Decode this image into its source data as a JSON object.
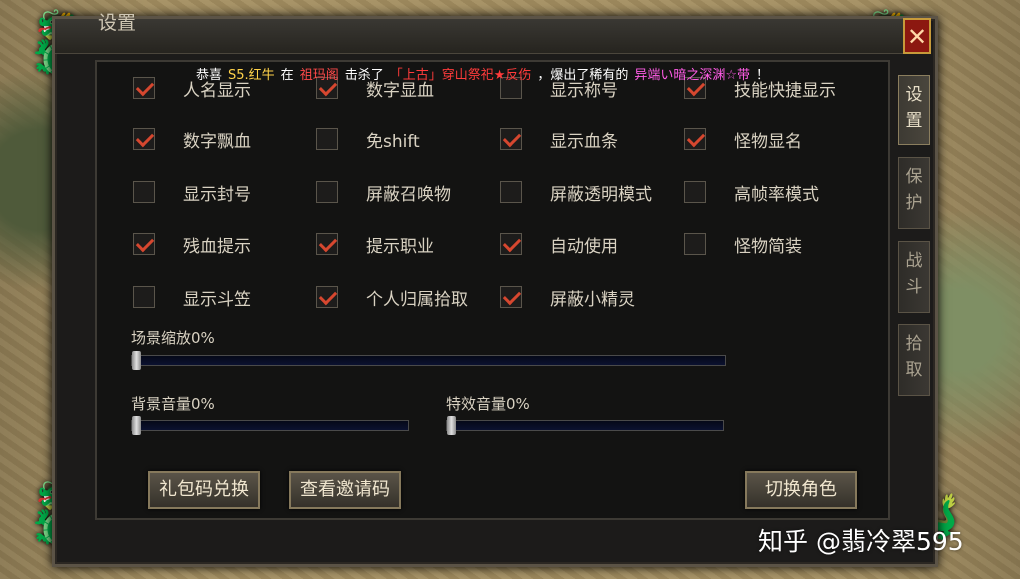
{
  "window": {
    "title": "设置",
    "close_glyph": "✕"
  },
  "broadcast": [
    {
      "text": "恭喜",
      "color": "#ffffff"
    },
    {
      "text": "S5.红牛",
      "color": "#ffd24a"
    },
    {
      "text": "在",
      "color": "#ffffff"
    },
    {
      "text": "祖玛阁",
      "color": "#ff4a4a"
    },
    {
      "text": "击杀了",
      "color": "#ffffff"
    },
    {
      "text": "「上古」穿山祭祀★反伤",
      "color": "#ff3b3b"
    },
    {
      "text": "，爆出了稀有的",
      "color": "#ffffff"
    },
    {
      "text": "异端い暗之深渊☆带",
      "color": "#ff5ce6"
    },
    {
      "text": "！",
      "color": "#ffffff"
    }
  ],
  "options": [
    {
      "label": "人名显示",
      "checked": true
    },
    {
      "label": "数字显血",
      "checked": true
    },
    {
      "label": "显示称号",
      "checked": false
    },
    {
      "label": "技能快捷显示",
      "checked": true
    },
    {
      "label": "数字飘血",
      "checked": true
    },
    {
      "label": "免shift",
      "checked": false
    },
    {
      "label": "显示血条",
      "checked": true
    },
    {
      "label": "怪物显名",
      "checked": true
    },
    {
      "label": "显示封号",
      "checked": false
    },
    {
      "label": "屏蔽召唤物",
      "checked": false
    },
    {
      "label": "屏蔽透明模式",
      "checked": false
    },
    {
      "label": "高帧率模式",
      "checked": false
    },
    {
      "label": "残血提示",
      "checked": true
    },
    {
      "label": "提示职业",
      "checked": true
    },
    {
      "label": "自动使用",
      "checked": true
    },
    {
      "label": "怪物简装",
      "checked": false
    },
    {
      "label": "显示斗笠",
      "checked": false
    },
    {
      "label": "个人归属拾取",
      "checked": true
    },
    {
      "label": "屏蔽小精灵",
      "checked": true
    }
  ],
  "sliders": [
    {
      "label": "场景缩放0%",
      "value": 0
    },
    {
      "label": "背景音量0%",
      "value": 0
    },
    {
      "label": "特效音量0%",
      "value": 0
    }
  ],
  "buttons": {
    "gift_code": "礼包码兑换",
    "view_invite": "查看邀请码",
    "switch_role": "切换角色"
  },
  "tabs": [
    {
      "label": "设置",
      "active": true
    },
    {
      "label": "保护",
      "active": false
    },
    {
      "label": "战斗",
      "active": false
    },
    {
      "label": "拾取",
      "active": false
    }
  ],
  "watermark": "知乎 @翡冷翠595",
  "colors": {
    "check": "#d6472f",
    "close_bg": "#8c1810",
    "track": "#0b1130"
  }
}
